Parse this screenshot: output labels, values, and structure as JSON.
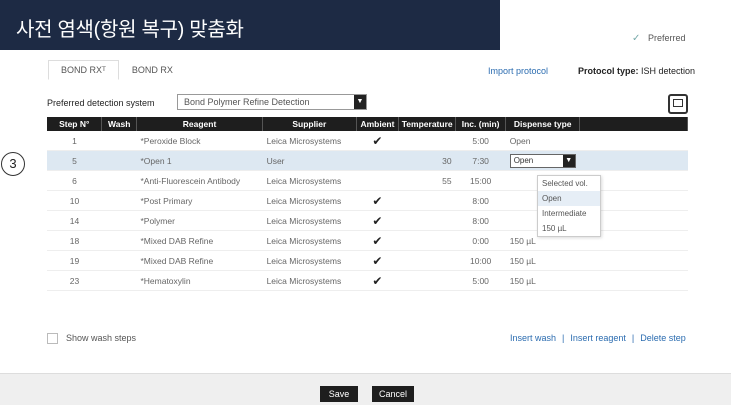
{
  "banner": {
    "title": "사전 염색(항원 복구) 맞춤화"
  },
  "preferred": {
    "label": "Preferred",
    "checked": true
  },
  "tabs": [
    {
      "label": "BOND RXᵀ",
      "active": true
    },
    {
      "label": "BOND RX",
      "active": false
    }
  ],
  "header_links": {
    "import_protocol": "Import protocol",
    "protocol_type_label": "Protocol type:",
    "protocol_type_value": "ISH detection"
  },
  "detection": {
    "label": "Preferred detection system",
    "value": "Bond Polymer Refine Detection"
  },
  "icons": {
    "printer": "printer-icon",
    "check": "check-icon",
    "dropdown_arrow": "triangle-down-icon"
  },
  "callout": "3",
  "table": {
    "headers": [
      "Step N°",
      "Wash",
      "Reagent",
      "Supplier",
      "Ambient",
      "Temperature",
      "Inc. (min)",
      "Dispense type"
    ],
    "rows": [
      {
        "step": "1",
        "wash": "",
        "reagent": "*Peroxide Block",
        "supplier": "Leica Microsystems",
        "ambient": true,
        "temperature": "",
        "inc": "5:00",
        "dispense": "Open",
        "selected": false
      },
      {
        "step": "5",
        "wash": "",
        "reagent": "*Open 1",
        "supplier": "User",
        "ambient": false,
        "temperature": "30",
        "inc": "7:30",
        "dispense": "Open",
        "selected": true
      },
      {
        "step": "6",
        "wash": "",
        "reagent": "*Anti-Fluorescein Antibody",
        "supplier": "Leica Microsystems",
        "ambient": false,
        "temperature": "55",
        "inc": "15:00",
        "dispense": "",
        "selected": false
      },
      {
        "step": "10",
        "wash": "",
        "reagent": "*Post Primary",
        "supplier": "Leica Microsystems",
        "ambient": true,
        "temperature": "",
        "inc": "8:00",
        "dispense": "",
        "selected": false
      },
      {
        "step": "14",
        "wash": "",
        "reagent": "*Polymer",
        "supplier": "Leica Microsystems",
        "ambient": true,
        "temperature": "",
        "inc": "8:00",
        "dispense": "",
        "selected": false
      },
      {
        "step": "18",
        "wash": "",
        "reagent": "*Mixed DAB Refine",
        "supplier": "Leica Microsystems",
        "ambient": true,
        "temperature": "",
        "inc": "0:00",
        "dispense": "150 µL",
        "selected": false
      },
      {
        "step": "19",
        "wash": "",
        "reagent": "*Mixed DAB Refine",
        "supplier": "Leica Microsystems",
        "ambient": true,
        "temperature": "",
        "inc": "10:00",
        "dispense": "150 µL",
        "selected": false
      },
      {
        "step": "23",
        "wash": "",
        "reagent": "*Hematoxylin",
        "supplier": "Leica Microsystems",
        "ambient": true,
        "temperature": "",
        "inc": "5:00",
        "dispense": "150 µL",
        "selected": false
      }
    ]
  },
  "dispense_dropdown": {
    "options": [
      "Selected vol.",
      "Open",
      "Intermediate",
      "150 µL"
    ],
    "highlighted": "Open"
  },
  "bottom": {
    "show_wash_steps": "Show wash steps",
    "insert_wash": "Insert wash",
    "insert_reagent": "Insert reagent",
    "delete_step": "Delete step",
    "separator": "|"
  },
  "buttons": {
    "save": "Save",
    "cancel": "Cancel"
  }
}
